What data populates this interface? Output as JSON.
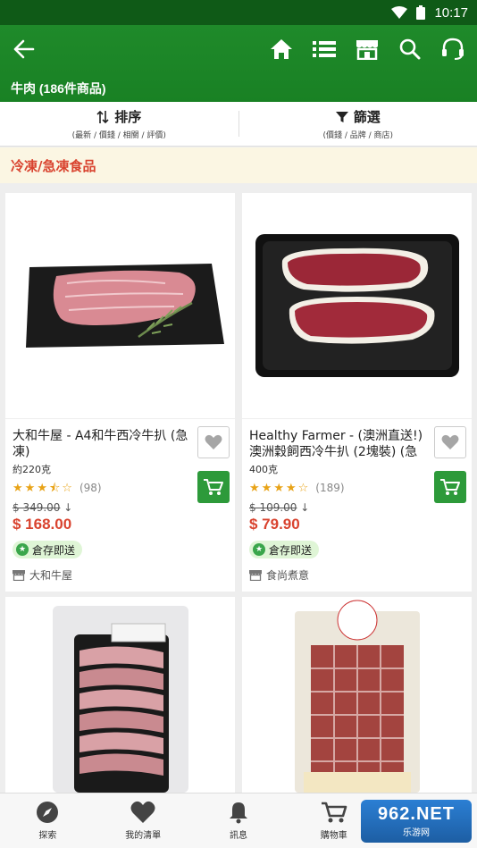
{
  "status_bar": {
    "time": "10:17"
  },
  "header": {
    "title": "牛肉 (186件商品)",
    "icons": [
      "back-arrow-icon",
      "home-icon",
      "list-icon",
      "store-icon",
      "search-icon",
      "headset-icon"
    ]
  },
  "sort_bar": {
    "sort_label": "排序",
    "sort_sub": "(最新 / 價錢 / 相關 / 評價)",
    "filter_label": "篩選",
    "filter_sub": "(價錢 / 品牌 / 商店)"
  },
  "category": {
    "label": "冷凍/急凍食品"
  },
  "products": [
    {
      "name": "大和牛屋 - A4和牛西冷牛扒 (急凍)",
      "weight": "約220克",
      "rating": 3.5,
      "reviews": "(98)",
      "old_price": "$ 349.00",
      "old_arrow": "↓",
      "price": "$ 168.00",
      "badge": "倉存即送",
      "shop": "大和牛屋"
    },
    {
      "name": "Healthy Farmer - (澳洲直送!) 澳洲穀飼西冷牛扒 (2塊裝) (急",
      "weight": "400克",
      "rating": 4,
      "reviews": "(189)",
      "old_price": "$ 109.00",
      "old_arrow": "↓",
      "price": "$ 79.90",
      "badge": "倉存即送",
      "shop": "食尚煮意"
    }
  ],
  "bottom_nav": [
    {
      "label": "探索",
      "icon": "compass-icon"
    },
    {
      "label": "我的清單",
      "icon": "heart-icon"
    },
    {
      "label": "訊息",
      "icon": "bell-icon"
    },
    {
      "label": "購物車",
      "icon": "cart-icon"
    },
    {
      "label": "",
      "icon": "account-icon"
    }
  ],
  "watermark": {
    "text": "962.NET",
    "sub": "乐游网"
  },
  "colors": {
    "header_green": "#1f8a2a",
    "status_green": "#0f5a17",
    "price_red": "#d9432f",
    "cart_green": "#2d9a3a",
    "banner_bg": "#fbf6e3"
  }
}
